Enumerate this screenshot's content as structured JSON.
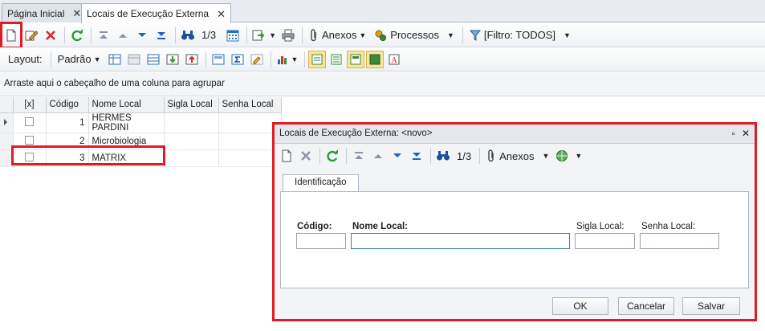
{
  "tabs": [
    {
      "label": "Página Inicial"
    },
    {
      "label": "Locais de Execução Externa"
    }
  ],
  "toolbar1": {
    "record_counter": "1/3",
    "anexos_label": "Anexos",
    "processos_label": "Processos",
    "filtro_label": "[Filtro: TODOS]"
  },
  "toolbar2": {
    "layout_label": "Layout:",
    "padrao_label": "Padrão"
  },
  "grouphint": "Arraste aqui o cabeçalho de uma coluna para agrupar",
  "grid": {
    "columns": [
      "[x]",
      "Código",
      "Nome Local",
      "Sigla Local",
      "Senha Local"
    ],
    "rows": [
      {
        "codigo": "1",
        "nome": "HERMES PARDINI",
        "sigla": "",
        "senha": ""
      },
      {
        "codigo": "2",
        "nome": "Microbiologia",
        "sigla": "",
        "senha": ""
      },
      {
        "codigo": "3",
        "nome": "MATRIX",
        "sigla": "",
        "senha": ""
      }
    ]
  },
  "dialog": {
    "title": "Locais de Execução Externa: <novo>",
    "record_counter": "1/3",
    "anexos_label": "Anexos",
    "tab_label": "Identificação",
    "fields": {
      "codigo_label": "Código:",
      "nome_label": "Nome Local:",
      "sigla_label": "Sigla Local:",
      "senha_label": "Senha Local:"
    },
    "buttons": {
      "ok": "OK",
      "cancel": "Cancelar",
      "save": "Salvar"
    }
  }
}
